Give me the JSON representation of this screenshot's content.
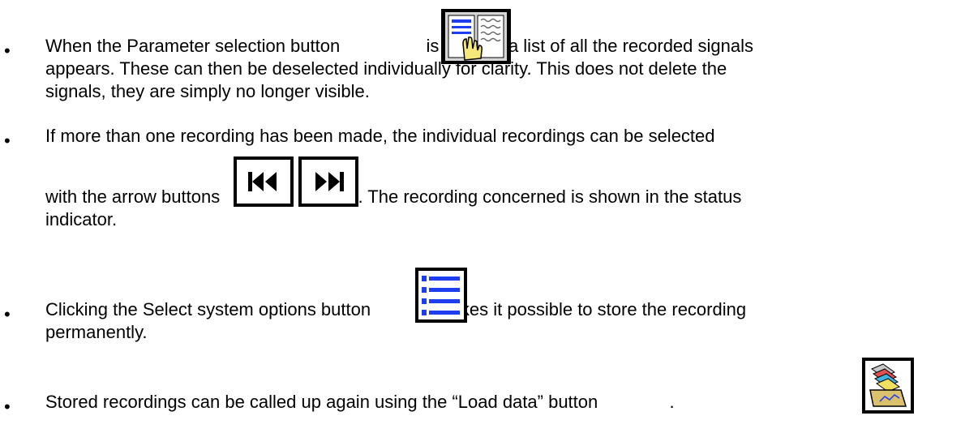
{
  "bullets": [
    {
      "lines": [
        {
          "before": "When the Parameter selection button",
          "after": "is clicked, a list of all the recorded signals"
        },
        {
          "text": "appears. These can then be deselected individually for clarity. This does not delete the"
        },
        {
          "text": "signals, they are simply no longer visible."
        }
      ],
      "icon": "parameter-selection-icon"
    },
    {
      "lines": [
        {
          "text": "If more than one recording has been made, the individual recordings can be selected"
        },
        {
          "before": "with the arrow buttons",
          "after": ". The recording concerned is shown in the status"
        },
        {
          "text": "indicator."
        }
      ],
      "icons": [
        "skip-back-icon",
        "skip-forward-icon"
      ]
    },
    {
      "lines": [
        {
          "before": "Clicking the Select system options button",
          "after": "makes it possible to store the recording"
        },
        {
          "text": "permanently."
        }
      ],
      "icon": "system-options-list-icon"
    },
    {
      "lines": [
        {
          "before": "Stored recordings can be called up again using the “Load data” button",
          "after": "."
        }
      ],
      "icon": "load-data-icon"
    }
  ],
  "bullet_symbol": "•",
  "colors": {
    "text": "#000000",
    "icon_blue": "#1e3cf0",
    "icon_frame": "#000000"
  }
}
